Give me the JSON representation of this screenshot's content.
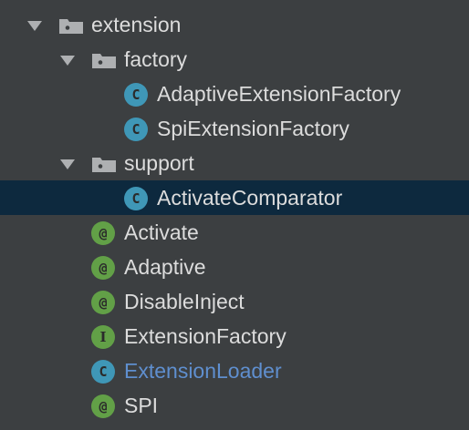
{
  "tree": {
    "items": [
      {
        "label": "extension",
        "type": "package",
        "expanded": true
      },
      {
        "label": "factory",
        "type": "package",
        "expanded": true
      },
      {
        "label": "AdaptiveExtensionFactory",
        "type": "class",
        "badge": "c"
      },
      {
        "label": "SpiExtensionFactory",
        "type": "class",
        "badge": "c"
      },
      {
        "label": "support",
        "type": "package",
        "expanded": true
      },
      {
        "label": "ActivateComparator",
        "type": "class",
        "badge": "c",
        "selected": true
      },
      {
        "label": "Activate",
        "type": "annotation",
        "badge": "@"
      },
      {
        "label": "Adaptive",
        "type": "annotation",
        "badge": "@"
      },
      {
        "label": "DisableInject",
        "type": "annotation",
        "badge": "@"
      },
      {
        "label": "ExtensionFactory",
        "type": "interface",
        "badge": "I"
      },
      {
        "label": "ExtensionLoader",
        "type": "class",
        "badge": "c",
        "label_color": "#5f8fcf"
      },
      {
        "label": "SPI",
        "type": "annotation",
        "badge": "@"
      }
    ]
  },
  "colors": {
    "background": "#3c3f41",
    "selection": "#0d293e",
    "text": "#dcdcdc",
    "class_badge": "#3f97b7",
    "annotation_badge": "#62a047",
    "link_text": "#5f8fcf"
  },
  "icons": {
    "expand": "chevron-down-icon",
    "package": "package-folder-icon",
    "class": "class-icon",
    "annotation": "annotation-icon",
    "interface": "interface-icon"
  }
}
